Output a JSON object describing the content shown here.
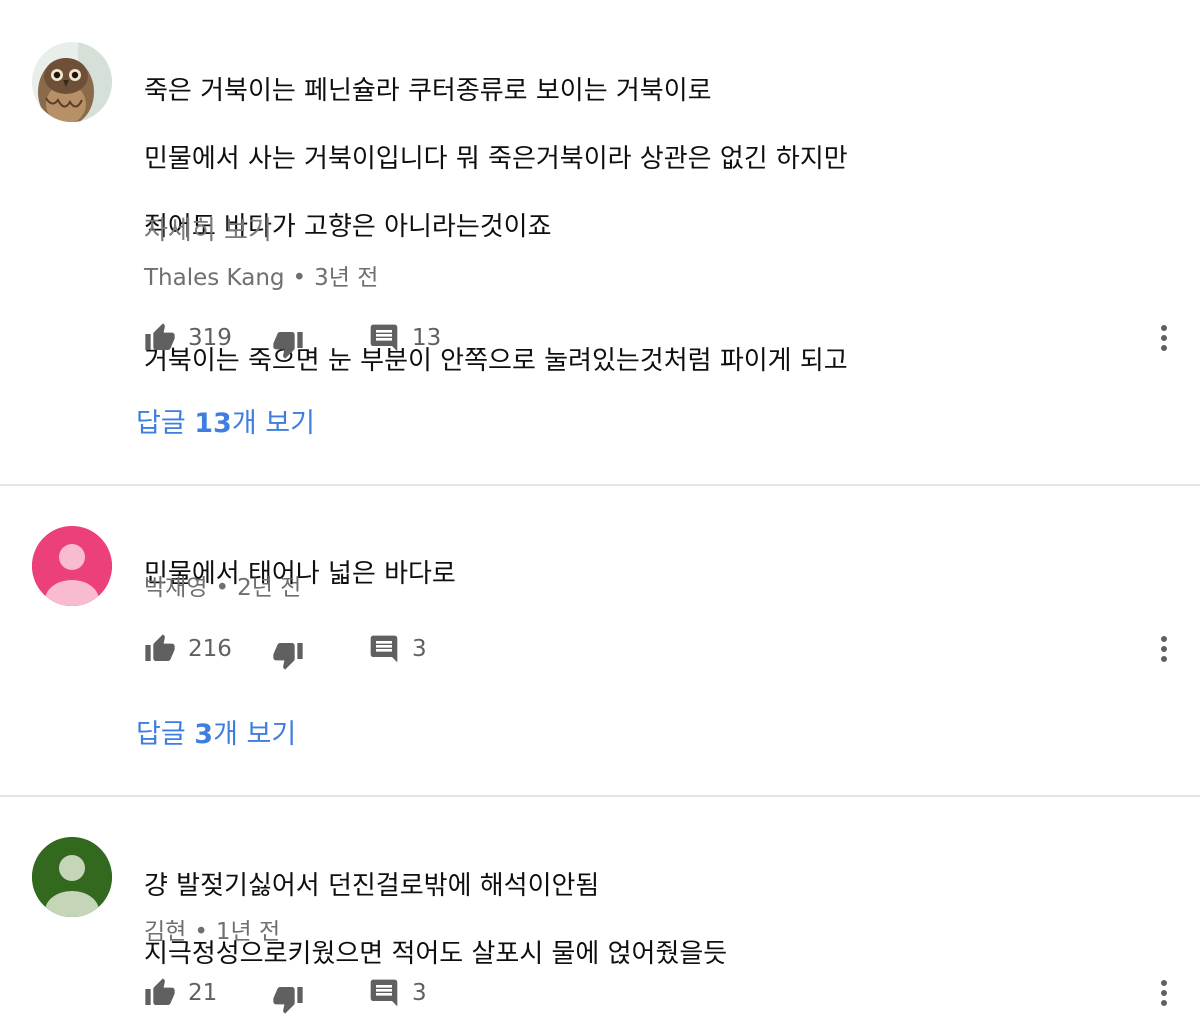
{
  "comments": [
    {
      "avatar_icon": "owl-photo",
      "text_lines": [
        "죽은 거북이는 페닌슐라 쿠터종류로 보이는 거북이로",
        "민물에서 사는 거북이입니다 뭐 죽은거북이라 상관은 없긴 하지만",
        "적어도 바다가 고향은 아니라는것이죠",
        "",
        "거북이는 죽으면 눈 부분이 안쪽으로 눌려있는것처럼 파이게 되고"
      ],
      "read_more": "자세히 보기",
      "author": "Thales Kang",
      "time": "3년 전",
      "likes": "319",
      "replies_count": "13",
      "replies_prefix": "답글 ",
      "replies_num": "13",
      "replies_suffix": "개 보기"
    },
    {
      "avatar_icon": "default-person-avatar",
      "avatar_color": "#ec407a",
      "text_lines": [
        "민물에서 태어나 넓은 바다로"
      ],
      "author": "박재영",
      "time": "2년 전",
      "likes": "216",
      "replies_count": "3",
      "replies_prefix": "답글 ",
      "replies_num": "3",
      "replies_suffix": "개 보기"
    },
    {
      "avatar_icon": "default-person-avatar",
      "avatar_color": "#33691e",
      "text_lines": [
        "걍 발젖기싫어서 던진걸로밖에 해석이안됨",
        "지극정성으로키웠으면 적어도 살포시 물에 얹어줬을듯"
      ],
      "author": "김현",
      "time": "1년 전",
      "likes": "21",
      "replies_count": "3"
    }
  ],
  "meta_separator": "•",
  "colors": {
    "link_blue": "#3f7ee0",
    "meta_gray": "#6f6f6f",
    "divider": "#e5e5e5"
  }
}
